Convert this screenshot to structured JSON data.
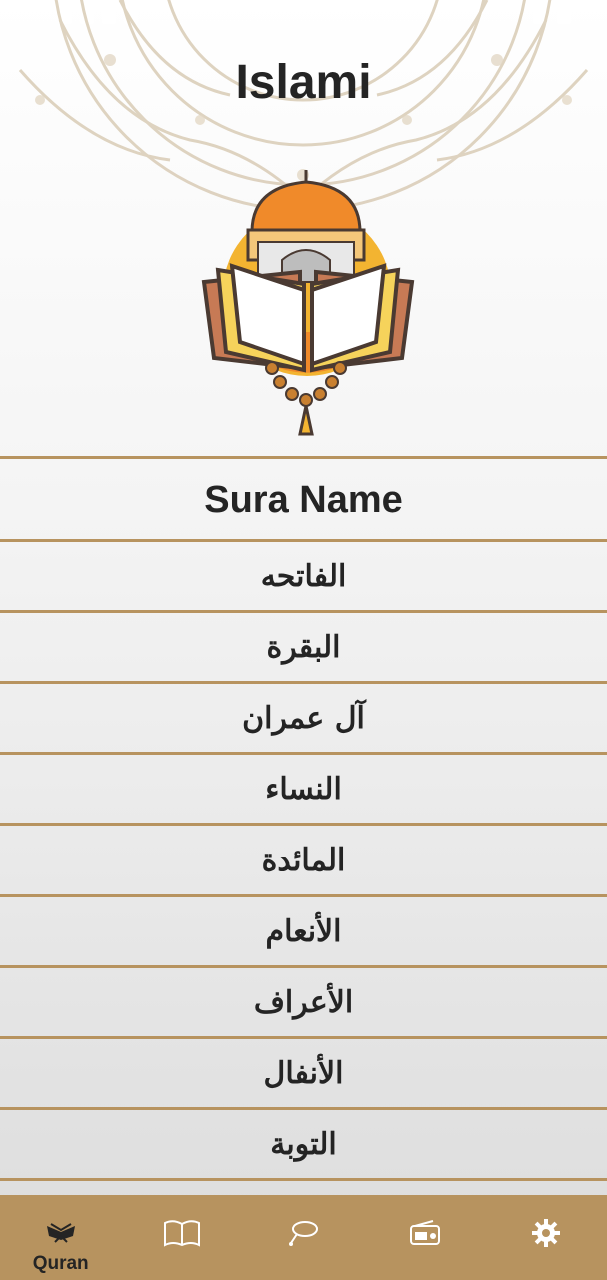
{
  "app": {
    "title": "Islami"
  },
  "list": {
    "header": "Sura Name",
    "suras": [
      "الفاتحه",
      "البقرة",
      "آل عمران",
      "النساء",
      "المائدة",
      "الأنعام",
      "الأعراف",
      "الأنفال",
      "التوبة"
    ]
  },
  "bottom_nav": {
    "active_label": "Quran",
    "items": [
      {
        "icon": "quran-icon",
        "label": "Quran"
      },
      {
        "icon": "book-icon"
      },
      {
        "icon": "sebha-icon"
      },
      {
        "icon": "radio-icon"
      },
      {
        "icon": "settings-icon"
      }
    ]
  },
  "colors": {
    "accent": "#B7935F",
    "text": "#242424"
  }
}
